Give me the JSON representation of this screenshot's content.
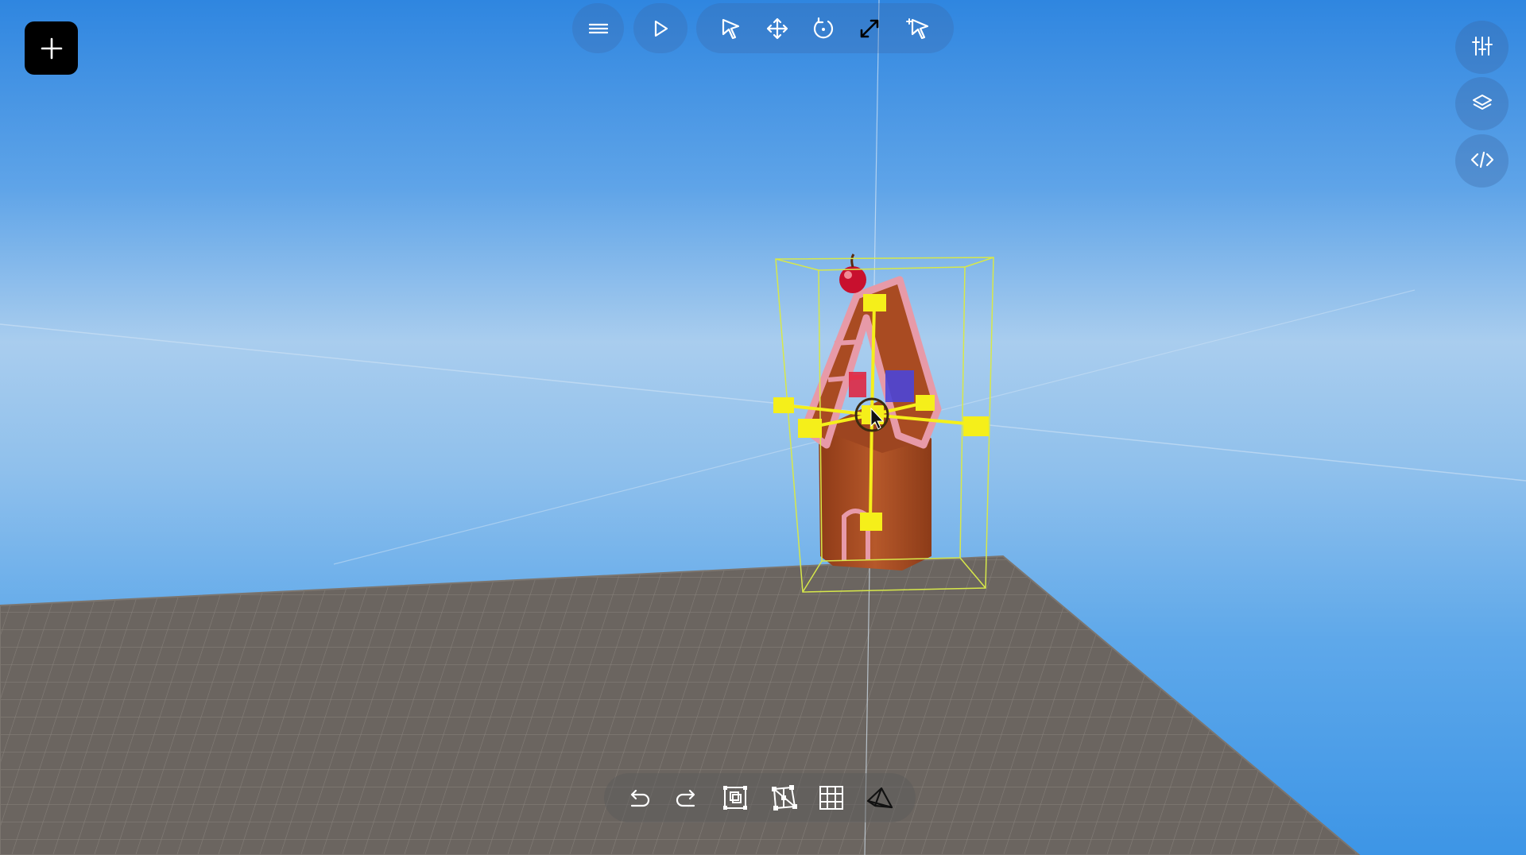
{
  "app": {
    "mode": "3D scene editor"
  },
  "colors": {
    "sky_top": "#2f86e0",
    "sky_horizon": "#a9cdee",
    "ground": "#6b6560",
    "grid_line": "#8a847e",
    "gizmo": "#f5ef1a",
    "bbox": "#d7e84a",
    "house_body": "#a94b22",
    "house_trim": "#e79aa8",
    "cherry": "#c8102e",
    "toolbar_bg": "#3a6aa8",
    "add_button_bg": "#000000"
  },
  "top_toolbar": {
    "menu": {
      "icon": "hamburger-menu-icon"
    },
    "play": {
      "icon": "play-icon"
    },
    "tools": [
      {
        "name": "select",
        "icon": "pointer-icon"
      },
      {
        "name": "move",
        "icon": "move-arrows-icon"
      },
      {
        "name": "rotate",
        "icon": "rotate-icon"
      },
      {
        "name": "scale",
        "icon": "scale-diagonal-icon",
        "active": true
      },
      {
        "name": "multi-select",
        "icon": "pointer-plus-icon"
      }
    ]
  },
  "right_panel": [
    {
      "name": "properties",
      "icon": "sliders-icon"
    },
    {
      "name": "layers",
      "icon": "layers-icon"
    },
    {
      "name": "code",
      "icon": "code-icon"
    }
  ],
  "bottom_toolbar": [
    {
      "name": "undo",
      "icon": "undo-icon"
    },
    {
      "name": "redo",
      "icon": "redo-icon"
    },
    {
      "name": "frame-selection",
      "icon": "frame-selection-icon"
    },
    {
      "name": "snap-points",
      "icon": "snap-points-icon"
    },
    {
      "name": "grid",
      "icon": "grid-icon"
    },
    {
      "name": "camera-view",
      "icon": "perspective-icon"
    }
  ]
}
